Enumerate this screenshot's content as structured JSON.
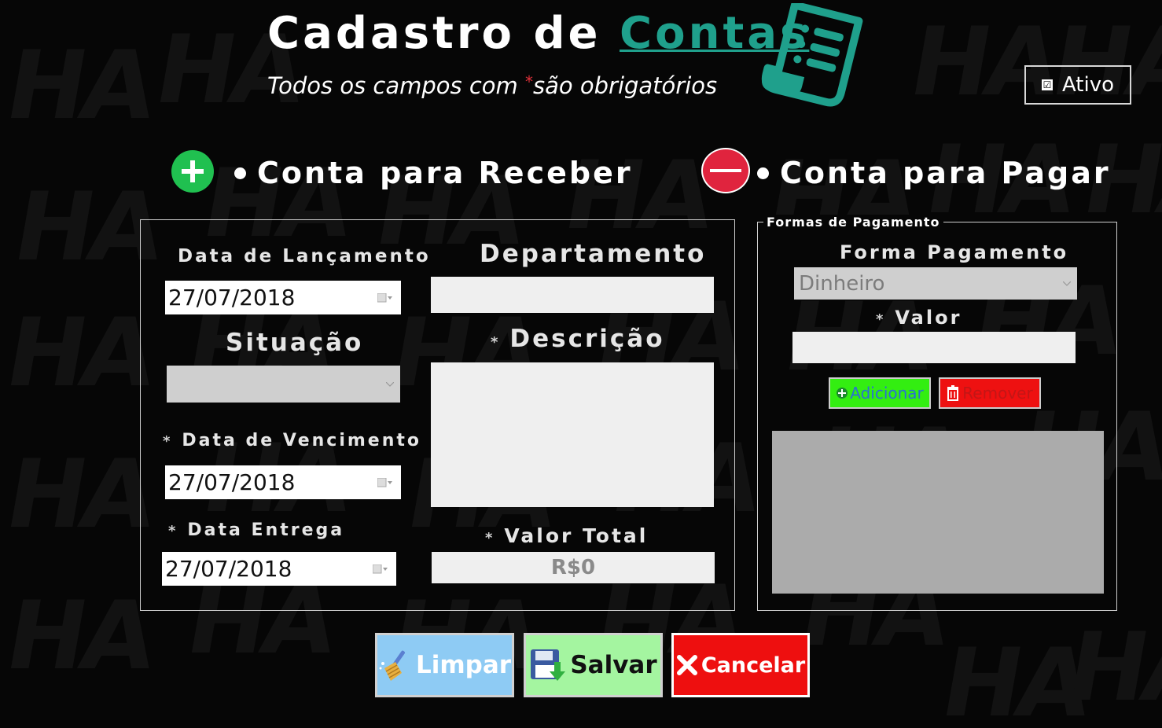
{
  "header": {
    "title_main": "Cadastro de",
    "title_accent": "Contas",
    "subtitle_before": "Todos os campos com ",
    "subtitle_star": "*",
    "subtitle_after": "são obrigatórios",
    "document_icon": "document-list-icon"
  },
  "ativo": {
    "label": "Ativo",
    "checked": true,
    "check_glyph": "☑"
  },
  "account_type": {
    "receive_label": "Conta para Receber",
    "receive_icon": "plus-circle-icon",
    "pay_label": "Conta para Pagar",
    "pay_icon": "minus-circle-icon"
  },
  "form": {
    "data_lancamento": {
      "label": "Data de Lançamento",
      "value": "27/07/2018"
    },
    "situacao": {
      "label": "Situação",
      "value": ""
    },
    "data_vencimento": {
      "star": "*",
      "label": "Data de Vencimento",
      "value": "27/07/2018"
    },
    "data_entrega": {
      "star": "*",
      "label": "Data Entrega",
      "value": "27/07/2018"
    },
    "departamento": {
      "label": "Departamento",
      "value": ""
    },
    "descricao": {
      "star": "*",
      "label": "Descrição",
      "value": ""
    },
    "valor_total": {
      "star": "*",
      "label": "Valor Total",
      "value": "R$0"
    }
  },
  "pagamento": {
    "legend": "Formas de Pagamento",
    "forma_label": "Forma Pagamento",
    "forma_value": "Dinheiro",
    "valor_star": "*",
    "valor_label": "Valor",
    "valor_value": "",
    "add_label": "Adicionar",
    "remove_label": "Remover"
  },
  "actions": {
    "limpar": "Limpar",
    "salvar": "Salvar",
    "cancelar": "Cancelar"
  },
  "colors": {
    "accent": "#1fa08c",
    "limpar_bg": "#8ecbf4",
    "salvar_bg": "#a4f5a0",
    "cancelar_bg": "#ee0f0f",
    "add_bg": "#33ee11",
    "remove_bg": "#ee1111"
  }
}
